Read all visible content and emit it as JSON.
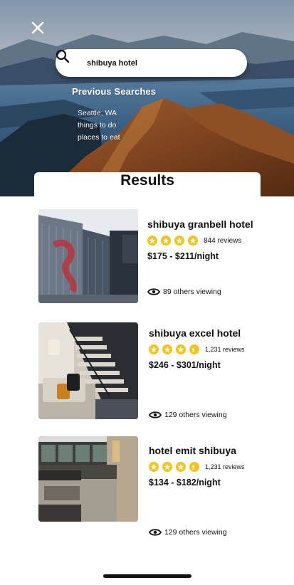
{
  "search": {
    "query": "shibuya hotel",
    "previous_title": "Previous Searches",
    "previous": [
      "Seattle, WA",
      "things to do",
      "places to eat"
    ]
  },
  "results_title": "Results",
  "hotels": [
    {
      "name": "shibuya granbell hotel",
      "rating": 4,
      "reviews": "844 reviews",
      "price": "$175 - $211/night",
      "viewing": "89 others viewing"
    },
    {
      "name": "shibuya excel hotel",
      "rating": 3.5,
      "reviews": "1,231 reviews",
      "price": "$246 - $301/night",
      "viewing": "129 others viewing"
    },
    {
      "name": "hotel emit shibuya",
      "rating": 3.5,
      "reviews": "1,231 reviews",
      "price": "$134 - $182/night",
      "viewing": "129 others viewing"
    }
  ],
  "colors": {
    "star": "#f6c318",
    "text": "#111111",
    "background": "#ffffff"
  },
  "icons": [
    "close-icon",
    "search-icon",
    "star-icon",
    "eye-icon"
  ]
}
